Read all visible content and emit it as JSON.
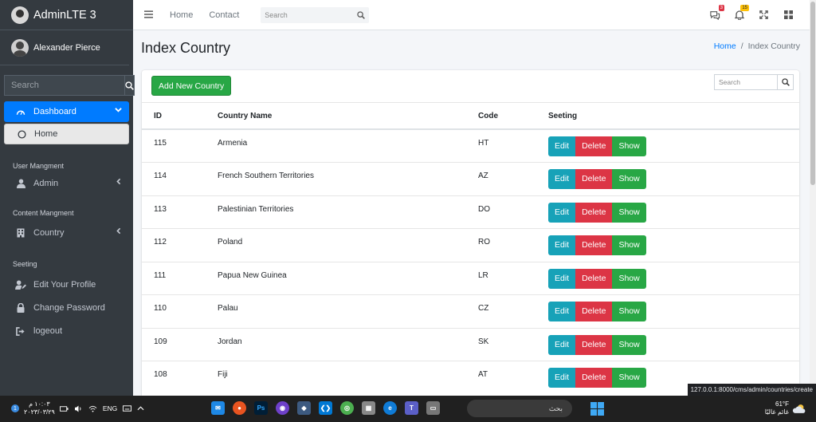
{
  "brand": {
    "name": "AdminLTE 3"
  },
  "user": {
    "name": "Alexander Pierce"
  },
  "sidebar": {
    "search_placeholder": "Search",
    "dashboard": "Dashboard",
    "home": "Home",
    "section_user": "User Mangment",
    "admin": "Admin",
    "section_content": "Content Mangment",
    "country": "Country",
    "section_setting": "Seeting",
    "edit_profile": "Edit Your Profile",
    "change_password": "Change Password",
    "logout": "logeout"
  },
  "topbar": {
    "home": "Home",
    "contact": "Contact",
    "search_placeholder": "Search",
    "messages_badge": "3",
    "notifications_badge": "15"
  },
  "page": {
    "title": "Index Country",
    "breadcrumb_home": "Home",
    "breadcrumb_sep": "/",
    "breadcrumb_current": "Index Country"
  },
  "card": {
    "add_button": "Add New Country",
    "search_placeholder": "Search"
  },
  "table": {
    "headers": {
      "id": "ID",
      "name": "Country Name",
      "code": "Code",
      "setting": "Seeting"
    },
    "rows": [
      {
        "id": "115",
        "name": "Armenia",
        "code": "HT"
      },
      {
        "id": "114",
        "name": "French Southern Territories",
        "code": "AZ"
      },
      {
        "id": "113",
        "name": "Palestinian Territories",
        "code": "DO"
      },
      {
        "id": "112",
        "name": "Poland",
        "code": "RO"
      },
      {
        "id": "111",
        "name": "Papua New Guinea",
        "code": "LR"
      },
      {
        "id": "110",
        "name": "Palau",
        "code": "CZ"
      },
      {
        "id": "109",
        "name": "Jordan",
        "code": "SK"
      },
      {
        "id": "108",
        "name": "Fiji",
        "code": "AT"
      }
    ],
    "actions": {
      "edit": "Edit",
      "delete": "Delete",
      "show": "Show"
    }
  },
  "status_url": "127.0.0.1:8000/cms/admin/countries/create",
  "taskbar": {
    "notif_count": "1",
    "time": "١٠:٠٣ م",
    "date": "٢٠٢٣/٠٣/٢٩",
    "lang": "ENG",
    "search_text": "بحث",
    "temp": "61°F",
    "weather_text": "غائم غالبًا"
  },
  "colors": {
    "primary": "#007bff",
    "success": "#28a745",
    "info": "#17a2b8",
    "danger": "#dc3545",
    "sidebar": "#343a40"
  }
}
